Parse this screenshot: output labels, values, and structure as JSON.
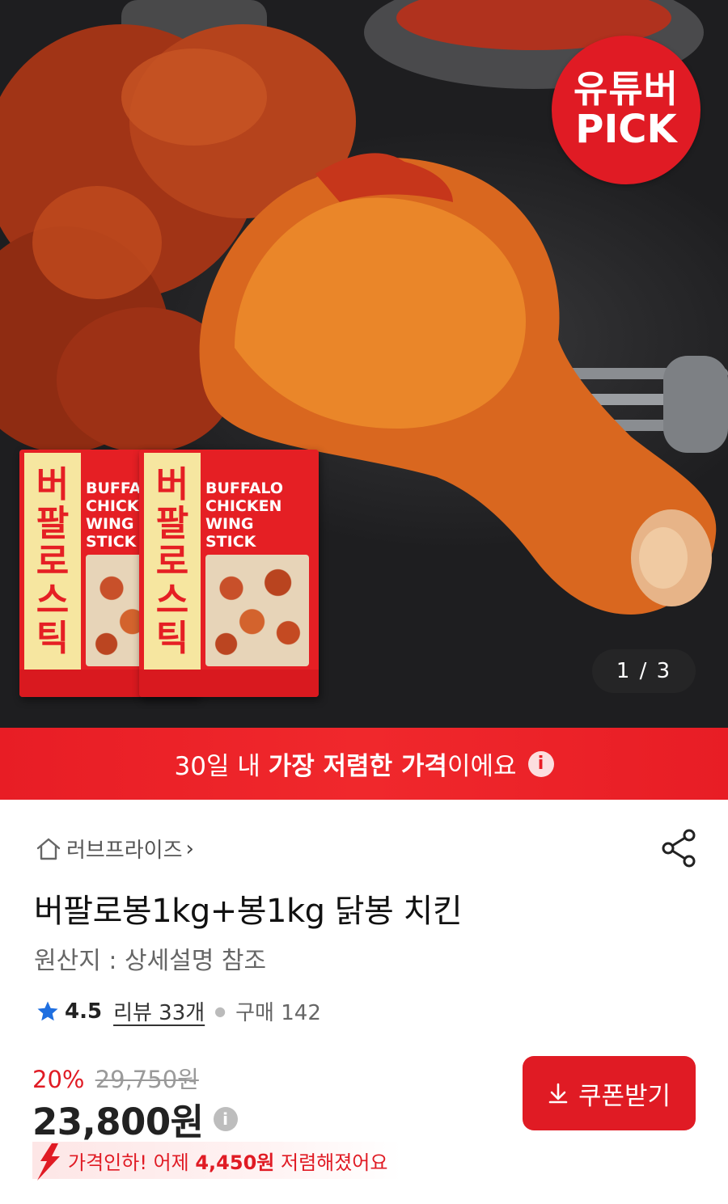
{
  "hero": {
    "badge_line1": "유튜버",
    "badge_line2": "PICK",
    "counter": "1 / 3",
    "package": {
      "korean_name_chars": [
        "버",
        "팔",
        "로",
        "스",
        "틱"
      ],
      "english_lines": [
        "BUFFALO",
        "CHICKEN",
        "WING",
        "STICK"
      ]
    }
  },
  "promo": {
    "prefix": "30일 내 ",
    "highlight": "가장 저렴한 가격",
    "suffix": "이에요"
  },
  "store": {
    "name": "러브프라이즈",
    "chevron": "›"
  },
  "product": {
    "title": "버팔로봉1kg+봉1kg 닭봉 치킨",
    "origin": "원산지 : 상세설명 참조",
    "rating": "4.5",
    "reviews": "리뷰 33개",
    "purchases": "구매 142",
    "discount_rate": "20%",
    "original_price": "29,750원",
    "price": "23,800원",
    "price_drop_prefix": "가격인하! 어제 ",
    "price_drop_amount": "4,450원",
    "price_drop_suffix": " 저렴해졌어요"
  },
  "actions": {
    "coupon_label": "쿠폰받기"
  },
  "colors": {
    "accent": "#e01b24",
    "badge": "#e01b24",
    "rating_star": "#1f6fe0"
  }
}
